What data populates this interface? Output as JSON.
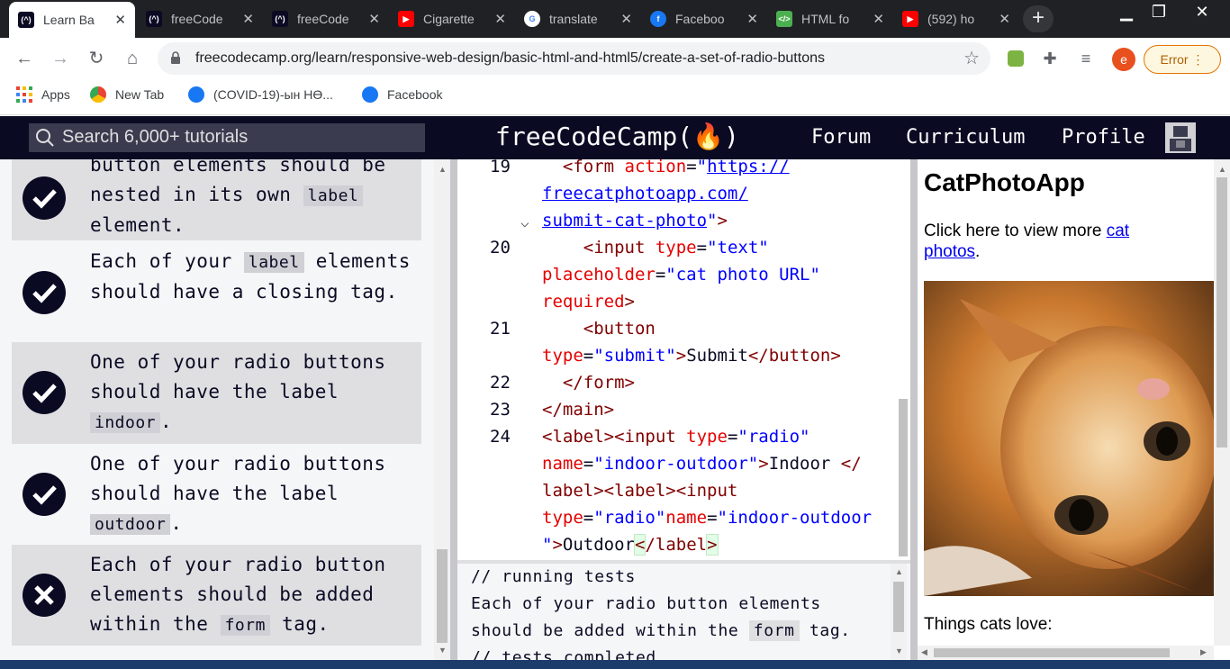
{
  "browser": {
    "tabs": [
      {
        "title": "Learn Ba",
        "icon": "freecodecamp-icon",
        "active": true
      },
      {
        "title": "freeCode",
        "icon": "freecodecamp-icon",
        "active": false
      },
      {
        "title": "freeCode",
        "icon": "freecodecamp-icon",
        "active": false
      },
      {
        "title": "Cigarette",
        "icon": "youtube-icon",
        "active": false
      },
      {
        "title": "translate",
        "icon": "google-icon",
        "active": false
      },
      {
        "title": "Faceboo",
        "icon": "facebook-icon",
        "active": false
      },
      {
        "title": "HTML fo",
        "icon": "html-icon",
        "active": false
      },
      {
        "title": "(592) ho",
        "icon": "youtube-icon",
        "active": false
      }
    ],
    "url": "freecodecamp.org/learn/responsive-web-design/basic-html-and-html5/create-a-set-of-radio-buttons",
    "profile_initial": "e",
    "error_label": "Error",
    "bookmarks": [
      {
        "label": "Apps",
        "icon": "apps-grid-icon"
      },
      {
        "label": "New Tab",
        "icon": "new-tab-icon"
      },
      {
        "label": "(COVID-19)-ын НӨ...",
        "icon": "facebook-icon"
      },
      {
        "label": "Facebook",
        "icon": "facebook-icon"
      }
    ],
    "colors": {
      "tabstrip": "#202124",
      "accent": "#1a73e8"
    }
  },
  "fcc_nav": {
    "search_placeholder": "Search 6,000+ tutorials",
    "brand": "freeCodeCamp(🔥)",
    "links": [
      "Forum",
      "Curriculum",
      "Profile"
    ],
    "colors": {
      "background": "#0a0a23",
      "search_bg": "#3b3b4f"
    }
  },
  "tests": [
    {
      "status": "pass",
      "parts": [
        "button elements should be nested in its own ",
        "label",
        " element."
      ]
    },
    {
      "status": "pass",
      "parts": [
        "Each of your ",
        "label",
        " elements should have a closing tag."
      ]
    },
    {
      "status": "pass",
      "parts": [
        "One of your radio buttons should have the label ",
        "indoor",
        "."
      ]
    },
    {
      "status": "pass",
      "parts": [
        "One of your radio buttons should have the label ",
        "outdoor",
        "."
      ]
    },
    {
      "status": "fail",
      "parts": [
        "Each of your radio button elements should be added within the ",
        "form",
        " tag."
      ]
    }
  ],
  "editor": {
    "line_numbers": [
      "19",
      "20",
      "21",
      "22",
      "23",
      "24"
    ]
  },
  "console": {
    "lines": [
      "// running tests",
      "Each of your radio button elements",
      "should be added within the ",
      "form",
      " tag.",
      "// tests completed"
    ]
  },
  "preview": {
    "heading": "CatPhotoApp",
    "text_before_link": "Click here to view more ",
    "link_text": "cat photos",
    "text_after_link": ".",
    "things_label": "Things cats love:"
  }
}
